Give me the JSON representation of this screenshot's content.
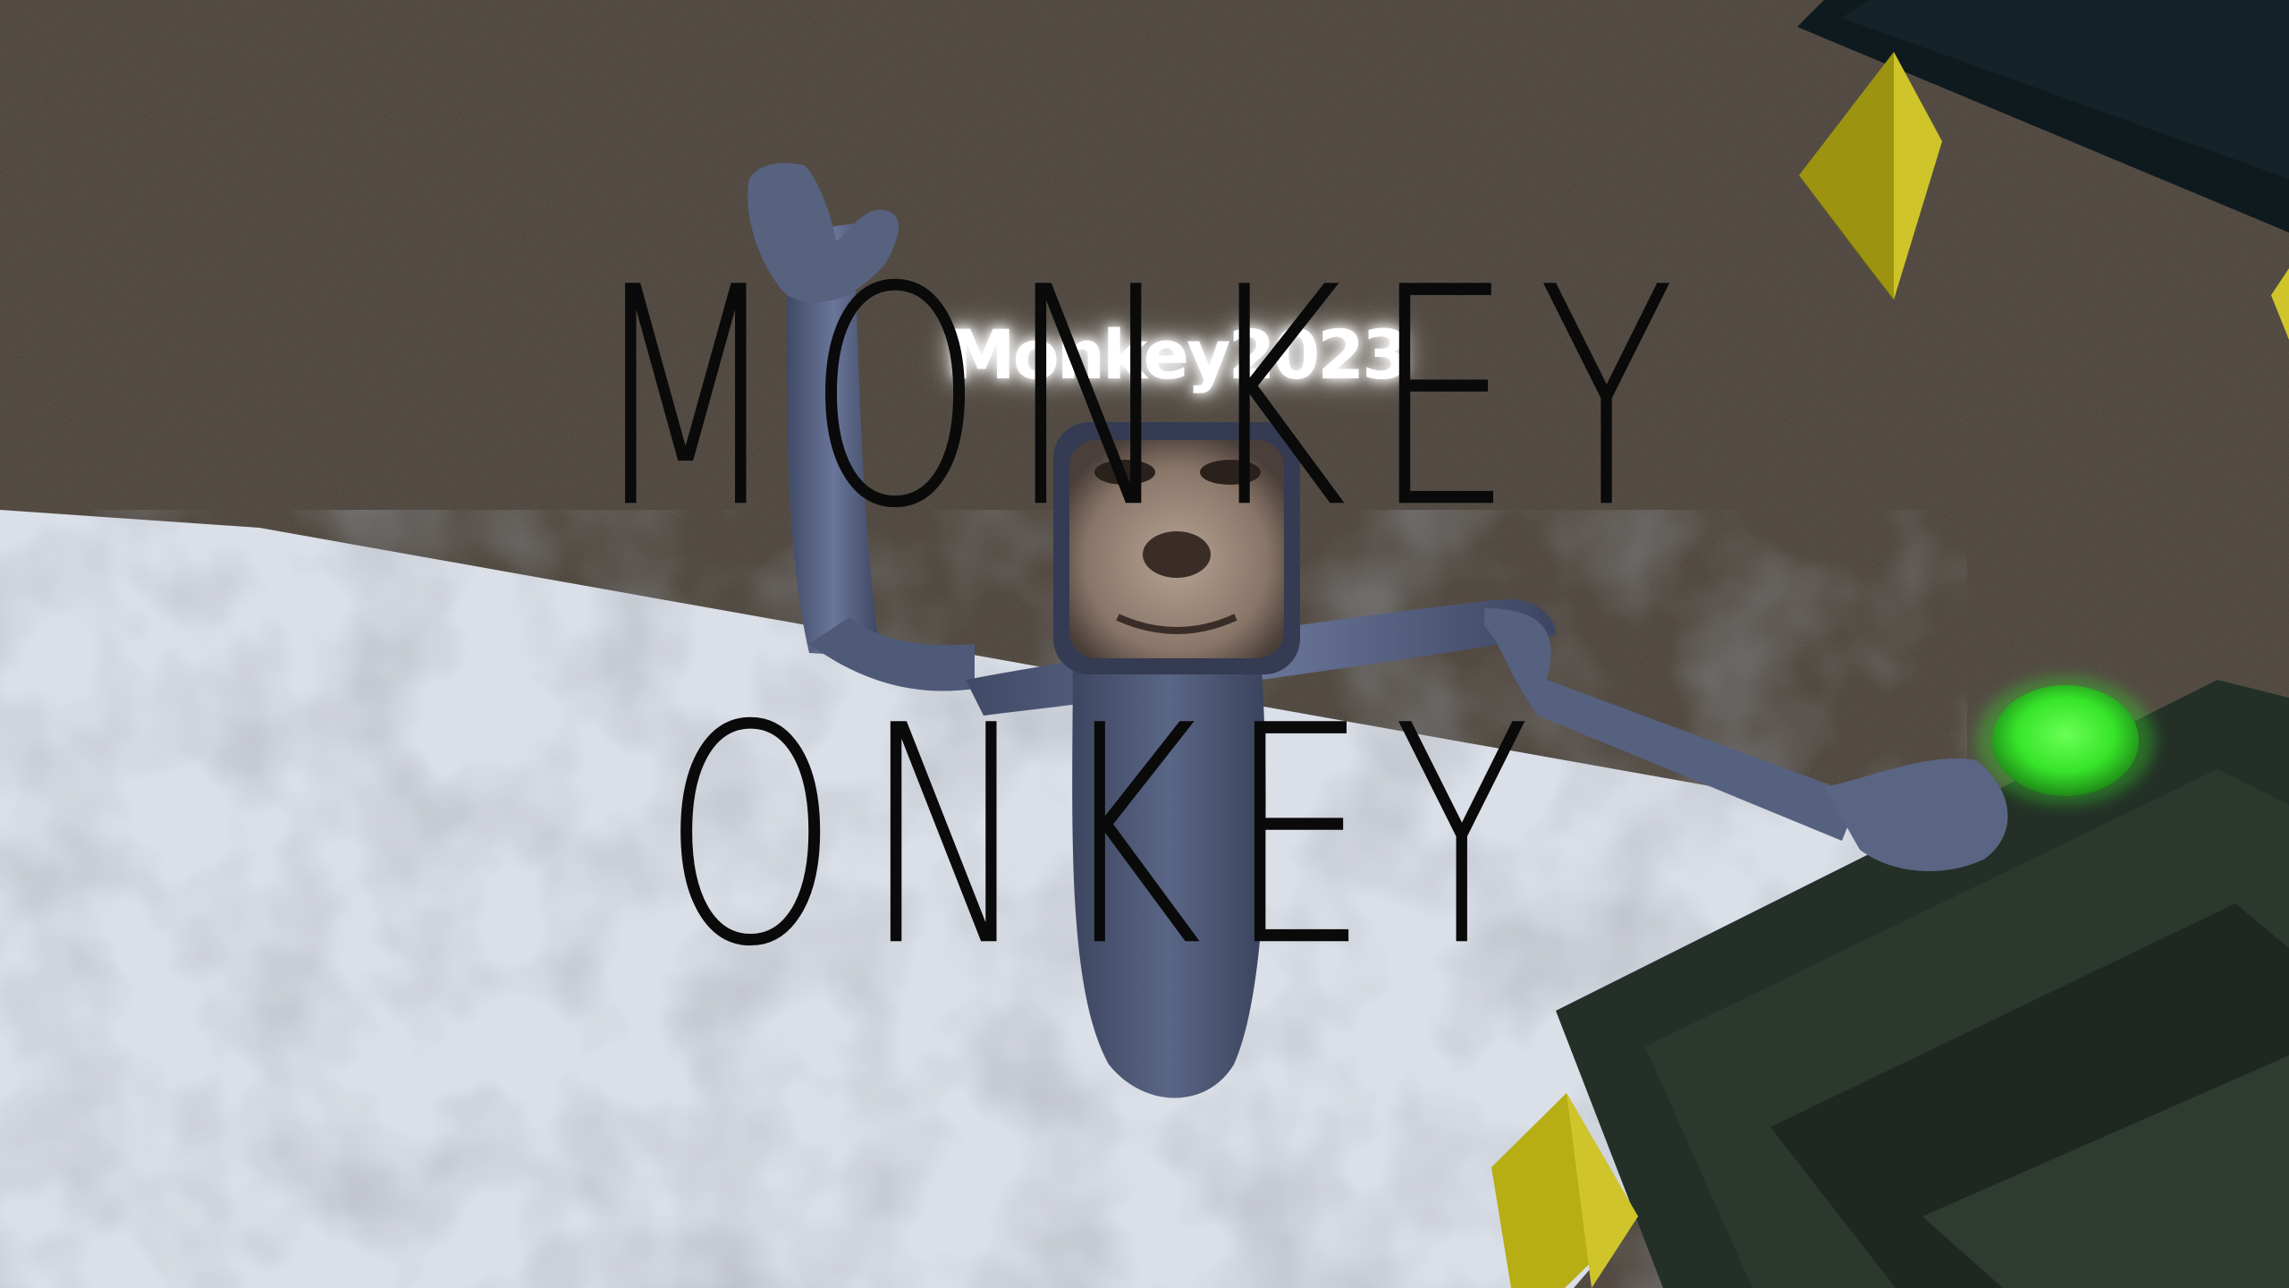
{
  "player": {
    "nametag": "Monkey2023"
  },
  "overlay": {
    "line1": "MONKEY",
    "line2": "ONKEY"
  },
  "colors": {
    "rock_wall": "#4f463c",
    "snow": "#d8dde6",
    "fur": "#4f5a78",
    "gem": "#b7ad14",
    "glow": "#37e52a",
    "tree": "#243027",
    "caption": "#0a0a0a"
  }
}
